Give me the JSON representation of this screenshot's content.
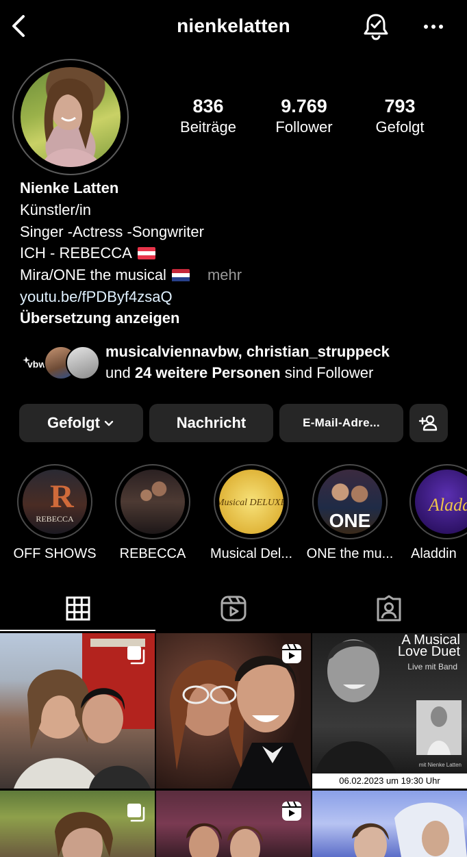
{
  "header": {
    "username": "nienkelatten",
    "back_icon": "chevron-left-icon",
    "bell_icon": "bell-check-icon",
    "more_icon": "more-dots-icon"
  },
  "stats": [
    {
      "value": "836",
      "label": "Beiträge"
    },
    {
      "value": "9.769",
      "label": "Follower"
    },
    {
      "value": "793",
      "label": "Gefolgt"
    }
  ],
  "bio": {
    "name": "Nienke Latten",
    "category": "Künstler/in",
    "line1": "Singer -Actress -Songwriter",
    "line2": "ICH - REBECCA",
    "line3": "Mira/ONE the musical",
    "more": "mehr",
    "link": "youtu.be/fPDByf4zsaQ",
    "translate": "Übersetzung anzeigen"
  },
  "followed_by": {
    "names": "musicalviennavbw, christian_struppeck",
    "prefix": "und",
    "count": "24 weitere Personen",
    "suffix": "sind Follower",
    "vbw_logo_text": "vbw"
  },
  "actions": {
    "following": "Gefolgt",
    "message": "Nachricht",
    "email": "E-Mail-Adre...",
    "add_person_icon": "add-person-icon"
  },
  "highlights": [
    {
      "label": "OFF SHOWS",
      "tile_text": "REBECCA"
    },
    {
      "label": "REBECCA",
      "tile_text": ""
    },
    {
      "label": "Musical Del...",
      "tile_text": "Musical DELUXE"
    },
    {
      "label": "ONE the mu...",
      "tile_text": "ONE"
    },
    {
      "label": "Aladdin",
      "tile_text": "Aladdin"
    }
  ],
  "tabs": [
    "grid-icon",
    "reels-icon",
    "tagged-icon"
  ],
  "posts": [
    {
      "kind": "carousel"
    },
    {
      "kind": "reel"
    },
    {
      "kind": "poster",
      "title": "A Musical Love Duet",
      "subtitle": "Live mit Band",
      "caption": "mit Nienke Latten",
      "date": "06.02.2023 um 19:30 Uhr"
    },
    {
      "kind": "carousel"
    },
    {
      "kind": "reel"
    },
    {
      "kind": "image"
    }
  ],
  "colors": {
    "background": "#000000",
    "button_bg": "#262626",
    "secondary_text": "#9a9a9a",
    "link_text": "#e0f1ff"
  }
}
